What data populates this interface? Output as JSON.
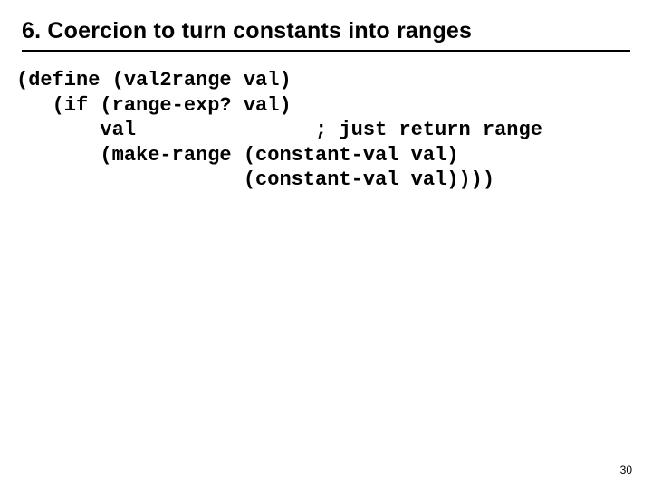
{
  "heading": "6. Coercion to turn constants into ranges",
  "code": "(define (val2range val)\n   (if (range-exp? val)\n       val               ; just return range\n       (make-range (constant-val val)\n                   (constant-val val))))",
  "page_number": "30"
}
